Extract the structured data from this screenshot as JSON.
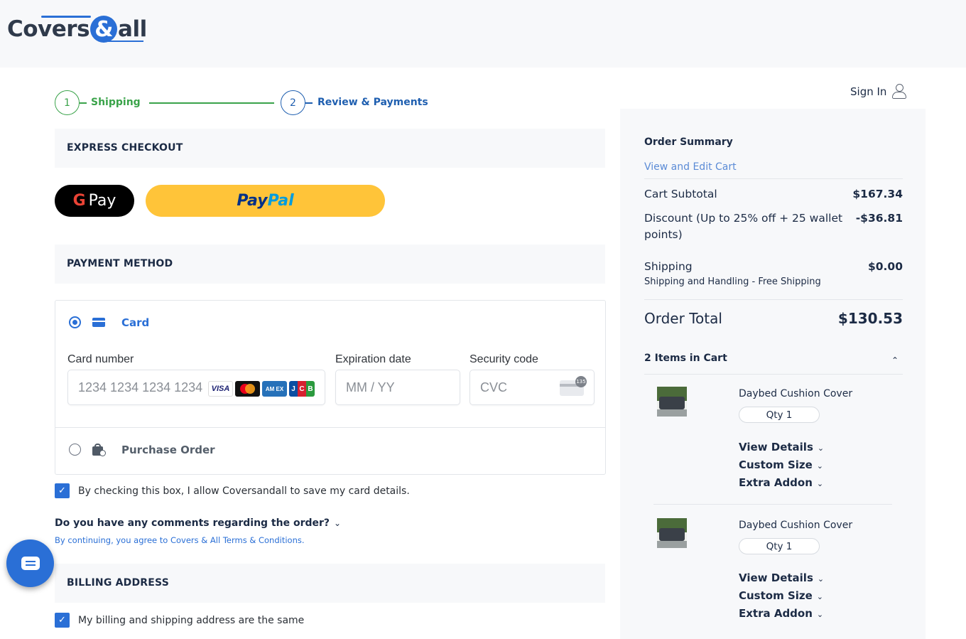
{
  "brand": {
    "logo_left": "Covers",
    "logo_amp": "&",
    "logo_right": "all"
  },
  "stepper": {
    "step1_number": "1",
    "step1_label": "Shipping",
    "step2_number": "2",
    "step2_label": "Review & Payments"
  },
  "express": {
    "title": "EXPRESS CHECKOUT",
    "gpay_g": "G",
    "gpay_label": "Pay",
    "paypal_a": "Pay",
    "paypal_b": "Pal"
  },
  "payment": {
    "title": "PAYMENT METHOD",
    "card_label": "Card",
    "card_number_label": "Card number",
    "card_number_placeholder": "1234 1234 1234 1234",
    "expiry_label": "Expiration date",
    "expiry_placeholder": "MM / YY",
    "cvc_label": "Security code",
    "cvc_placeholder": "CVC",
    "cvc_icon_number": "135",
    "brands": {
      "visa": "VISA",
      "amex": "AM EX",
      "jcb": [
        "J",
        "C",
        "B"
      ]
    },
    "purchase_order_label": "Purchase Order",
    "save_card_text": "By checking this box, I allow Coversandall to save my card details.",
    "save_card_checked": true
  },
  "comments": {
    "question": "Do you have any comments regarding the order?",
    "terms": "By continuing, you agree to Covers & All Terms & Conditions."
  },
  "billing": {
    "title": "BILLING ADDRESS",
    "same_text": "My billing and shipping address are the same",
    "same_checked": true
  },
  "account": {
    "sign_in": "Sign In"
  },
  "summary": {
    "title": "Order Summary",
    "edit_link": "View and Edit Cart",
    "subtotal_label": "Cart Subtotal",
    "subtotal_value": "$167.34",
    "discount_label": "Discount (Up to 25% off + 25 wallet points)",
    "discount_value": "-$36.81",
    "shipping_label": "Shipping",
    "shipping_value": "$0.00",
    "shipping_detail": "Shipping and Handling - Free Shipping",
    "total_label": "Order Total",
    "total_value": "$130.53",
    "items_count": "2 Items in Cart",
    "items": [
      {
        "name": "Daybed Cushion Cover",
        "qty": "Qty 1",
        "view_details": "View Details",
        "custom_size": "Custom Size",
        "extra_addon": "Extra Addon"
      },
      {
        "name": "Daybed Cushion Cover",
        "qty": "Qty 1",
        "view_details": "View Details",
        "custom_size": "Custom Size",
        "extra_addon": "Extra Addon"
      }
    ]
  },
  "colors": {
    "accent": "#2a6fd6",
    "success": "#3aa34a",
    "paypal_yellow": "#ffc439",
    "text": "#1c2b45"
  }
}
